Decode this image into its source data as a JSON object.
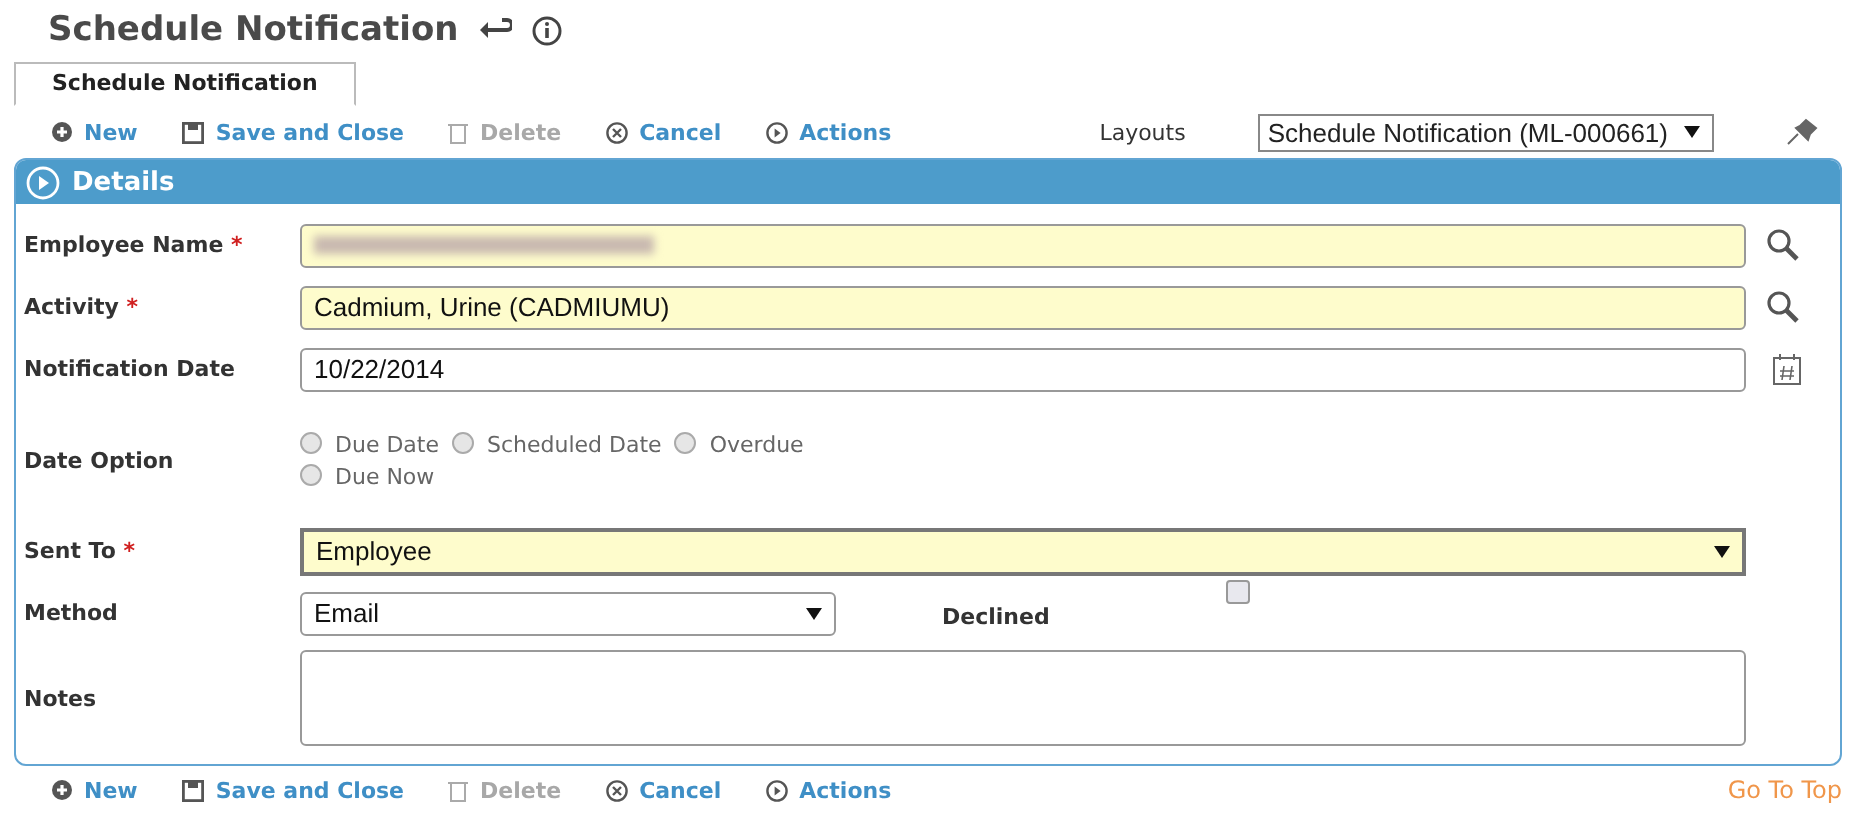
{
  "header": {
    "title": "Schedule Notification"
  },
  "tabs": [
    {
      "label": "Schedule Notification",
      "selected": true
    }
  ],
  "toolbar_top": [
    {
      "kind": "new",
      "label": "New",
      "disabled": false
    },
    {
      "kind": "save",
      "label": "Save and Close",
      "disabled": false
    },
    {
      "kind": "delete",
      "label": "Delete",
      "disabled": true
    },
    {
      "kind": "cancel",
      "label": "Cancel",
      "disabled": false
    },
    {
      "kind": "actions",
      "label": "Actions",
      "disabled": false
    }
  ],
  "layouts": {
    "label": "Layouts",
    "value": "Schedule Notification (ML-000661)"
  },
  "panel": {
    "title": "Details",
    "expanded": true,
    "fields": [
      {
        "kind": "lookup",
        "label": "Employee Name",
        "required_mark": "*",
        "redacted": true
      },
      {
        "kind": "lookup",
        "label": "Activity",
        "required_mark": "*",
        "value": "Cadmium, Urine (CADMIUMU)"
      },
      {
        "kind": "date",
        "label": "Notification Date",
        "value": "10/22/2014"
      },
      {
        "kind": "radio",
        "label": "Date Option",
        "options": [
          {
            "label": "Due Date",
            "selected": false
          },
          {
            "label": "Scheduled Date",
            "selected": false
          },
          {
            "label": "Overdue",
            "selected": false
          },
          {
            "label": "Due Now",
            "selected": false
          }
        ]
      },
      {
        "kind": "select",
        "label": "Sent To",
        "required_mark": "*",
        "value": "Employee"
      },
      {
        "kind": "select_check",
        "label": "Method",
        "value": "Email",
        "check_label": "Declined",
        "checked": false
      },
      {
        "kind": "textarea",
        "label": "Notes"
      }
    ]
  },
  "toolbar_bottom": [
    {
      "kind": "new",
      "label": "New",
      "disabled": false
    },
    {
      "kind": "save",
      "label": "Save and Close",
      "disabled": false
    },
    {
      "kind": "delete",
      "label": "Delete",
      "disabled": true
    },
    {
      "kind": "cancel",
      "label": "Cancel",
      "disabled": false
    },
    {
      "kind": "actions",
      "label": "Actions",
      "disabled": false
    }
  ],
  "go_to_top": "Go To Top"
}
